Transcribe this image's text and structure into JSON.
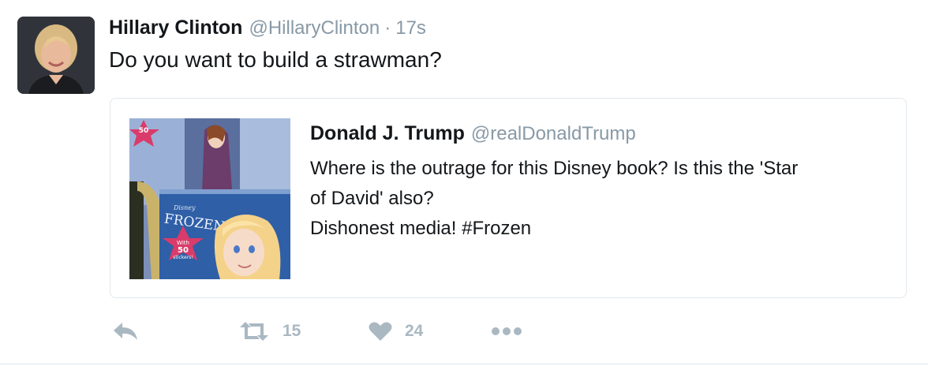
{
  "tweet": {
    "author_name": "Hillary Clinton",
    "author_handle": "@HillaryClinton",
    "separator": "·",
    "time": "17s",
    "text": "Do you want to build a strawman?",
    "avatar_icon": "profile-photo",
    "quoted": {
      "author_name": "Donald J. Trump",
      "author_handle": "@realDonaldTrump",
      "text_lines": [
        "Where is the outrage for this Disney book? Is this the 'Star",
        "of David' also?",
        "Dishonest media! #Frozen"
      ],
      "media": {
        "brand": "Disney",
        "title": "FROZEN",
        "star_top_text": "50 stickers!",
        "star_text": [
          "With",
          "50",
          "stickers!"
        ]
      }
    },
    "actions": {
      "reply_icon": "reply-icon",
      "retweet_icon": "retweet-icon",
      "retweet_count": "15",
      "like_icon": "heart-icon",
      "like_count": "24",
      "more_icon": "more-icon"
    },
    "colors": {
      "text": "#14171a",
      "muted": "#8899a6",
      "action_gray": "#aab8c2",
      "border": "#e1e8ed"
    }
  }
}
